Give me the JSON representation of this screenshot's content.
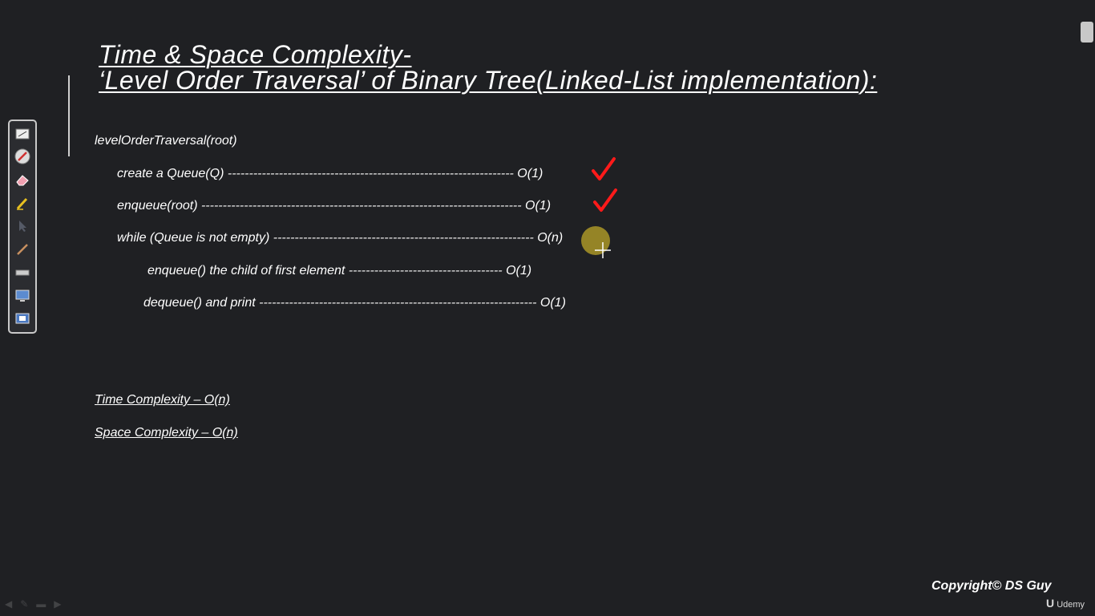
{
  "title": {
    "line1": "Time & Space Complexity-",
    "line2": "‘Level Order Traversal’ of Binary Tree(Linked-List implementation):"
  },
  "code": {
    "header": "levelOrderTraversal(root)",
    "lines": [
      {
        "text": "create a Queue(Q)",
        "dashes": "-------------------------------------------------------------------",
        "complexity": "O(1)"
      },
      {
        "text": "enqueue(root)",
        "dashes": "---------------------------------------------------------------------------",
        "complexity": "O(1)"
      },
      {
        "text": "while (Queue is not empty)",
        "dashes": "-------------------------------------------------------------",
        "complexity": "O(n)"
      },
      {
        "text": "enqueue() the child of first element",
        "dashes": "------------------------------------",
        "complexity": "O(1)"
      },
      {
        "text": "dequeue() and print",
        "dashes": "-----------------------------------------------------------------",
        "complexity": "O(1)"
      }
    ]
  },
  "summary": {
    "time": "Time Complexity – O(n)",
    "space": "Space Complexity – O(n)"
  },
  "footer": {
    "copyright": "Copyright© DS Guy",
    "brand": "Udemy"
  },
  "colors": {
    "background": "#1f2023",
    "check": "#ff1a1a",
    "pointer": "#bea528"
  },
  "toolbar": {
    "tools": [
      "presentation-icon",
      "pen-icon",
      "eraser-icon",
      "highlighter-icon",
      "arrow-pointer-icon",
      "marker-icon",
      "ruler-icon",
      "screen-icon",
      "screen-capture-icon"
    ]
  }
}
